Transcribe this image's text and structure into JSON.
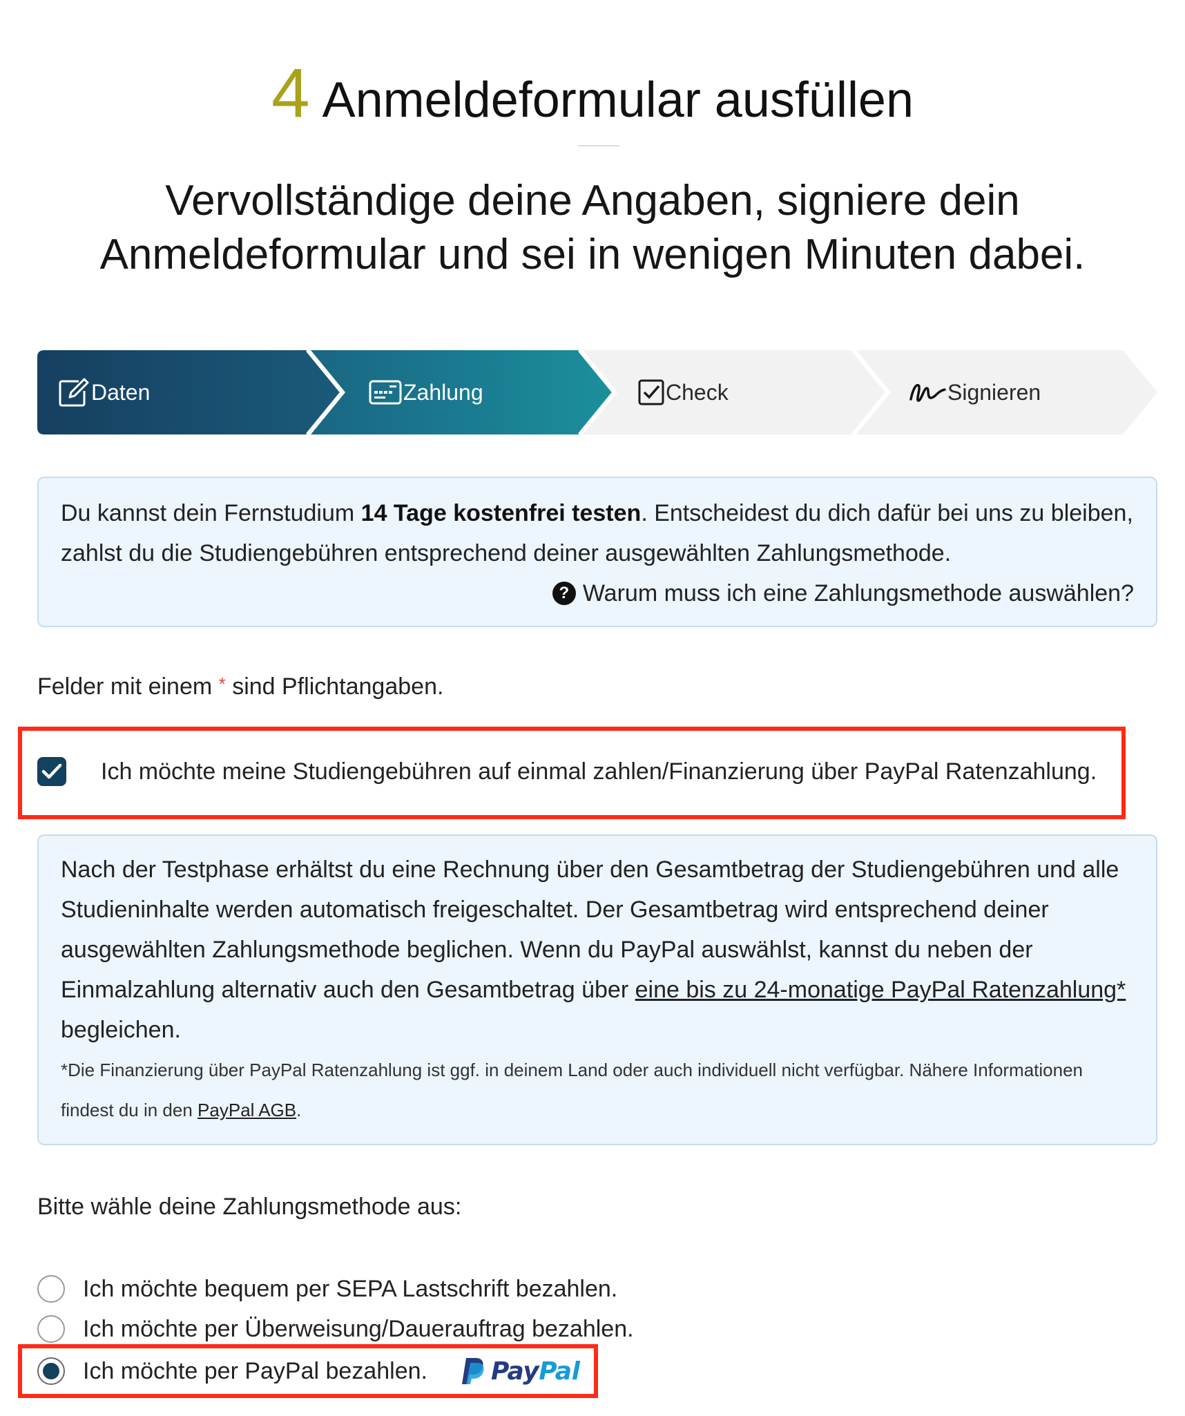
{
  "header": {
    "step_number": "4",
    "title": "Anmeldeformular ausfüllen",
    "subtitle_line1": "Vervollständige deine Angaben, signiere dein",
    "subtitle_line2": "Anmeldeformular und sei in wenigen Minuten dabei."
  },
  "stepper": {
    "steps": [
      {
        "label": "Daten",
        "icon": "edit-icon",
        "state": "active"
      },
      {
        "label": "Zahlung",
        "icon": "credit-card-icon",
        "state": "active"
      },
      {
        "label": "Check",
        "icon": "checkbox-icon",
        "state": "inactive"
      },
      {
        "label": "Signieren",
        "icon": "signature-icon",
        "state": "inactive"
      }
    ],
    "colors": {
      "step1": "#17476a",
      "step2": "#1b8a99",
      "inactive": "#f2f2f2"
    }
  },
  "trial_info": {
    "text_before": "Du kannst dein Fernstudium ",
    "text_bold": "14 Tage kostenfrei testen",
    "text_after": ". Entscheidest du dich dafür bei uns zu bleiben, zahlst du die Studiengebühren entsprechend deiner ausgewählten Zahlungsmethode.",
    "why_link": "Warum muss ich eine Zahlungsmethode auswählen?"
  },
  "required_note": {
    "before": "Felder mit einem ",
    "star": "*",
    "after": " sind Pflichtangaben."
  },
  "one_time_payment": {
    "checked": true,
    "label": "Ich möchte meine Studiengebühren auf einmal zahlen/Finanzierung über PayPal Ratenzahlung."
  },
  "payment_info": {
    "text_before": "Nach der Testphase erhältst du eine Rechnung über den Gesamtbetrag der Studiengebühren und alle Studieninhalte werden automatisch freigeschaltet. Der Gesamtbetrag wird entsprechend deiner ausgewählten Zahlungsmethode beglichen. Wenn du PayPal auswählst, kannst du neben der Einmalzahlung alternativ auch den Gesamtbetrag über ",
    "link": "eine bis zu 24-monatige PayPal Ratenzahlung*",
    "text_after": " begleichen.",
    "footnote_before": "*Die Finanzierung über PayPal Ratenzahlung ist ggf. in deinem Land oder auch individuell nicht verfügbar. Nähere Informationen findest du in den ",
    "footnote_link": "PayPal AGB",
    "footnote_after": "."
  },
  "payment_methods": {
    "label": "Bitte wähle deine Zahlungsmethode aus:",
    "options": [
      {
        "label": "Ich möchte bequem per SEPA Lastschrift bezahlen.",
        "selected": false
      },
      {
        "label": "Ich möchte per Überweisung/Dauerauftrag bezahlen.",
        "selected": false
      },
      {
        "label": "Ich möchte per PayPal bezahlen.",
        "selected": true
      }
    ],
    "paypal_logo": {
      "part1": "Pay",
      "part2": "Pal",
      "color1": "#253b80",
      "color2": "#179bd7"
    }
  },
  "highlight_color": "#ff2a17"
}
